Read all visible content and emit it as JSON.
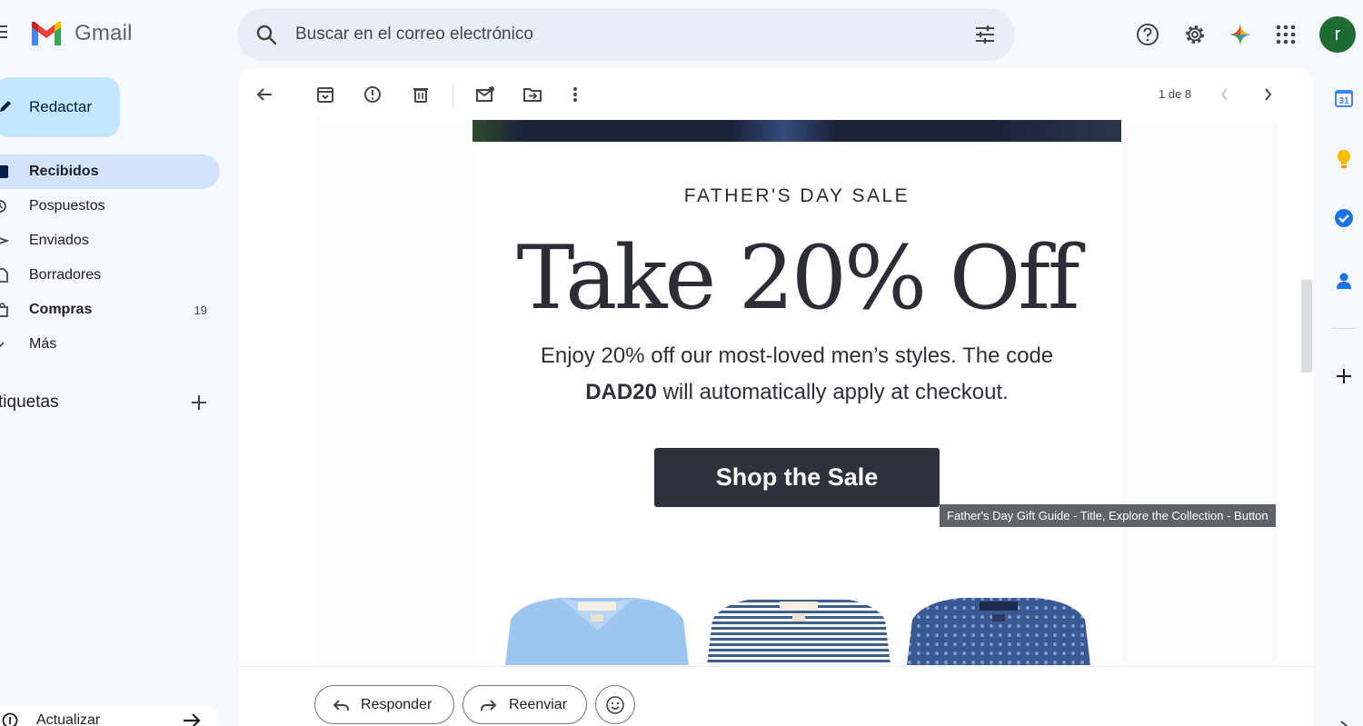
{
  "app": {
    "name": "Gmail"
  },
  "search": {
    "placeholder": "Buscar en el correo electrónico"
  },
  "compose": {
    "label": "Redactar"
  },
  "nav": [
    {
      "label": "Recibidos",
      "active": true,
      "bold": true,
      "count": ""
    },
    {
      "label": "Pospuestos",
      "active": false,
      "bold": false,
      "count": ""
    },
    {
      "label": "Enviados",
      "active": false,
      "bold": false,
      "count": ""
    },
    {
      "label": "Borradores",
      "active": false,
      "bold": false,
      "count": ""
    },
    {
      "label": "Compras",
      "active": false,
      "bold": true,
      "count": "19"
    },
    {
      "label": "Más",
      "active": false,
      "bold": false,
      "count": ""
    }
  ],
  "labels_section": {
    "title": "tiquetas"
  },
  "update_bar": {
    "label": "Actualizar"
  },
  "toolbar": {
    "pager": "1 de 8"
  },
  "email": {
    "kicker": "FATHER'S DAY SALE",
    "headline": "Take 20% Off",
    "body_line1": "Enjoy 20% off our most-loved men’s styles. The code",
    "body_code": "DAD20",
    "body_line2": " will automatically apply at checkout.",
    "cta": "Shop the Sale",
    "shirt_colors": [
      "#9cc6f0",
      "#3e5f8d",
      "#3a5894"
    ]
  },
  "tooltip": "Father's Day Gift Guide - Title, Explore the Collection - Button",
  "reply": {
    "reply_label": "Responder",
    "forward_label": "Reenviar"
  },
  "user": {
    "initial": "r",
    "avatar_color": "#1e6b33"
  },
  "side_apps": {
    "calendar_day": "31"
  },
  "colors": {
    "accent": "#c2e7ff",
    "active_nav": "#d3e3fd",
    "cta": "#30323b"
  }
}
